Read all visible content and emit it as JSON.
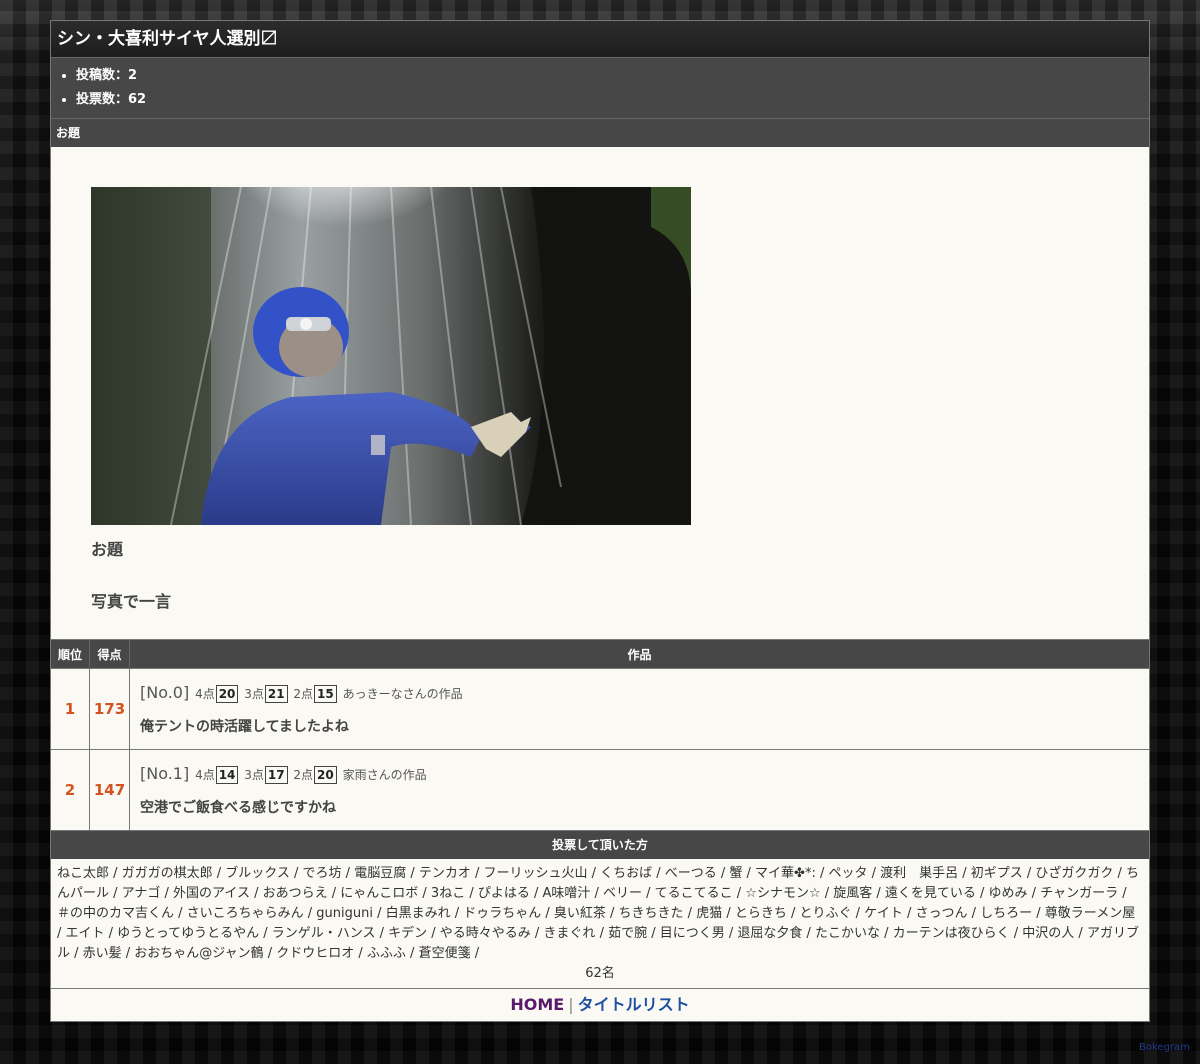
{
  "page": {
    "title": "シン・大喜利サイヤ人選別〼",
    "stats": [
      {
        "label": "投稿数：",
        "value": "2"
      },
      {
        "label": "投票数：",
        "value": "62"
      }
    ]
  },
  "odai": {
    "section_label": "お題",
    "heading": "お題",
    "text": "写真で一言",
    "photo_alt": "photo"
  },
  "ranking": {
    "headers": {
      "rank": "順位",
      "score": "得点",
      "work": "作品"
    },
    "rows": [
      {
        "rank": "1",
        "score": "173",
        "no": "[No.0]",
        "votes": [
          {
            "label": "4点",
            "count": "20"
          },
          {
            "label": "3点",
            "count": "21"
          },
          {
            "label": "2点",
            "count": "15"
          }
        ],
        "author": "あっきーなさんの作品",
        "text": "俺テントの時活躍してましたよね"
      },
      {
        "rank": "2",
        "score": "147",
        "no": "[No.1]",
        "votes": [
          {
            "label": "4点",
            "count": "14"
          },
          {
            "label": "3点",
            "count": "17"
          },
          {
            "label": "2点",
            "count": "20"
          }
        ],
        "author": "家雨さんの作品",
        "text": "空港でご飯食べる感じですかね"
      }
    ]
  },
  "voters": {
    "heading": "投票して頂いた方",
    "list": "ねこ太郎 / ガガガの棋太郎 / ブルックス / でろ坊 / 電脳豆腐 / テンカオ / フーリッシュ火山 / くちおば / べーつる / 蟹 / マイ華✤*: / ペッタ / 渡利　巣手呂 / 初ギプス / ひざガクガク / ちんパール / アナゴ / 外国のアイス / おあつらえ / にゃんこロボ / 3ねこ / ぴよはる / A味噌汁 / ベリー / てるこてるこ / ☆シナモン☆ / 旋風客 / 遠くを見ている / ゆめみ / チャンガーラ / ＃の中のカマ吉くん / さいころちゃらみん / guniguni / 白黒まみれ / ドゥラちゃん / 臭い紅茶 / ちきちきた / 虎猫 / とらきち / とりふぐ / ケイト / さっつん / しちろー / 尊敬ラーメン屋 / エイト / ゆうとってゆうとるやん / ランゲル・ハンス / キデン / やる時々やるみ / きまぐれ / 茹で腕 / 目につく男 / 退屈な夕食 / たこかいな / カーテンは夜ひらく / 中沢の人 / アガリブル / 赤い髪 / おおちゃん@ジャン鶴 / クドウヒロオ / ふふふ / 蒼空便箋 /",
    "count": "62名"
  },
  "footer": {
    "home": "HOME",
    "separator": "|",
    "title_list": "タイトルリスト"
  },
  "brand": "Bokegram"
}
